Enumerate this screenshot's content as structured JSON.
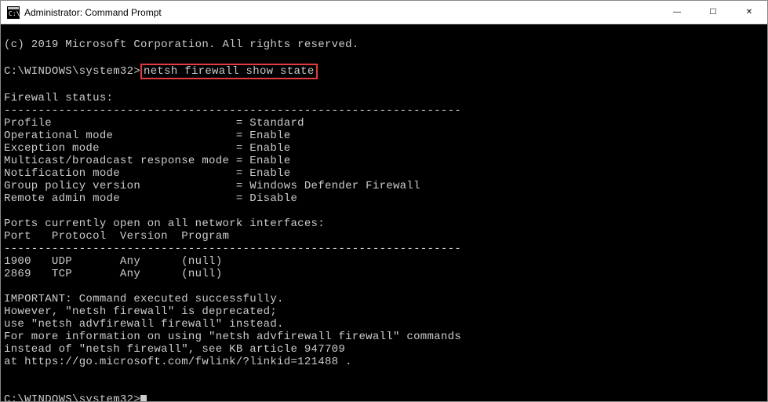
{
  "window": {
    "title": "Administrator: Command Prompt",
    "icon": "cmd-icon"
  },
  "controls": {
    "minimize": "—",
    "maximize": "☐",
    "close": "✕"
  },
  "terminal": {
    "copyright": "(c) 2019 Microsoft Corporation. All rights reserved.",
    "blank": "",
    "prompt1_prefix": "C:\\WINDOWS\\system32>",
    "prompt1_cmd": "netsh firewall show state",
    "status_header": "Firewall status:",
    "divider": "-------------------------------------------------------------------",
    "row_profile": "Profile                           = Standard",
    "row_opmode": "Operational mode                  = Enable",
    "row_excmode": "Exception mode                    = Enable",
    "row_multicast": "Multicast/broadcast response mode = Enable",
    "row_notif": "Notification mode                 = Enable",
    "row_gpv": "Group policy version              = Windows Defender Firewall",
    "row_remote": "Remote admin mode                 = Disable",
    "ports_header": "Ports currently open on all network interfaces:",
    "ports_columns": "Port   Protocol  Version  Program",
    "port_row1": "1900   UDP       Any      (null)",
    "port_row2": "2869   TCP       Any      (null)",
    "important1": "IMPORTANT: Command executed successfully.",
    "important2": "However, \"netsh firewall\" is deprecated;",
    "important3": "use \"netsh advfirewall firewall\" instead.",
    "important4": "For more information on using \"netsh advfirewall firewall\" commands",
    "important5": "instead of \"netsh firewall\", see KB article 947709",
    "important6": "at https://go.microsoft.com/fwlink/?linkid=121488 .",
    "prompt2": "C:\\WINDOWS\\system32>"
  }
}
